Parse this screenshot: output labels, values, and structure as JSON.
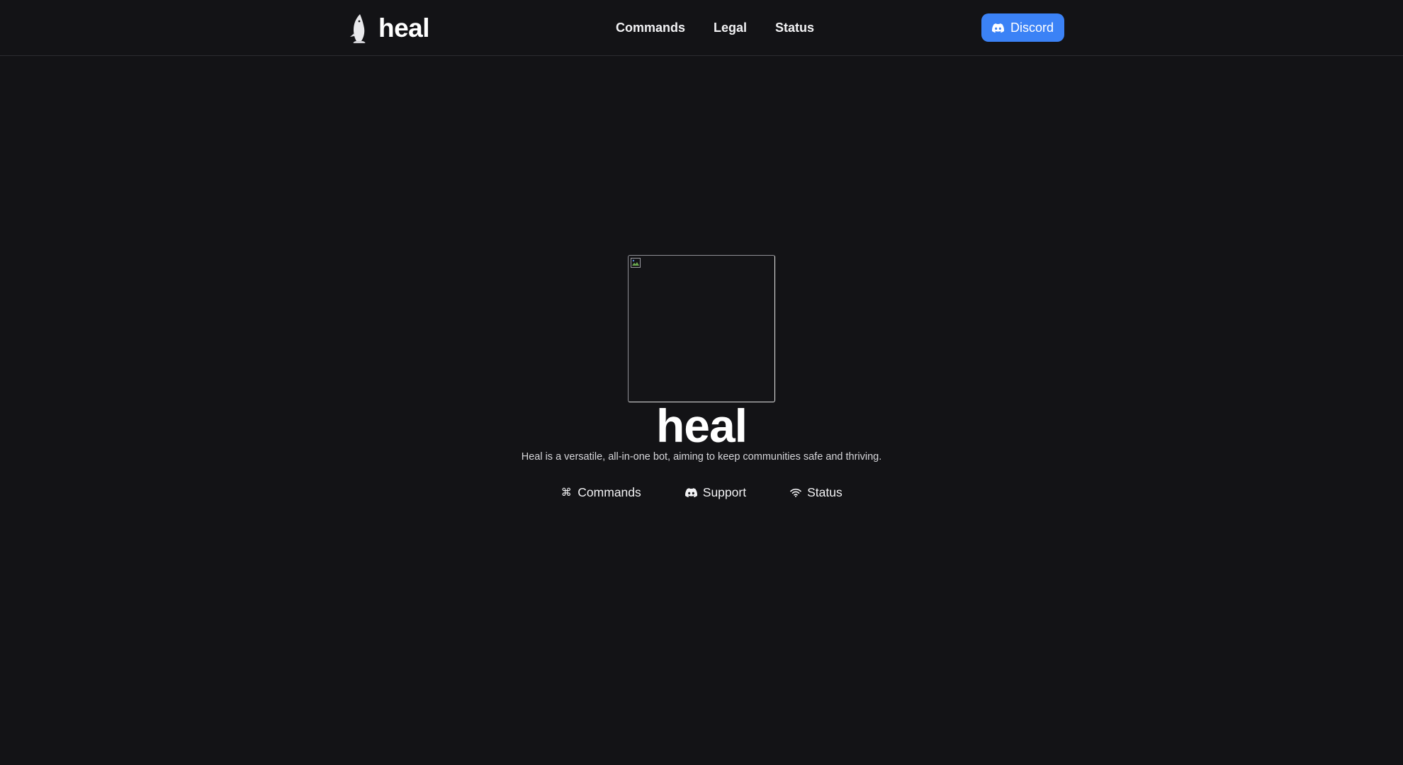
{
  "header": {
    "brand_name": "heal",
    "nav": [
      {
        "label": "Commands"
      },
      {
        "label": "Legal"
      },
      {
        "label": "Status"
      }
    ],
    "discord_button": {
      "label": "Discord",
      "icon": "discord-icon"
    }
  },
  "hero": {
    "avatar_icon": "broken-image-icon",
    "title": "heal",
    "description": "Heal is a versatile, all-in-one bot, aiming to keep communities safe and thriving.",
    "links": [
      {
        "label": "Commands",
        "icon": "command-icon"
      },
      {
        "label": "Support",
        "icon": "discord-icon"
      },
      {
        "label": "Status",
        "icon": "wifi-icon"
      }
    ]
  },
  "colors": {
    "background": "#131316",
    "accent": "#3b82f6",
    "text": "#f5f5f7",
    "divider": "#2c2c31"
  }
}
